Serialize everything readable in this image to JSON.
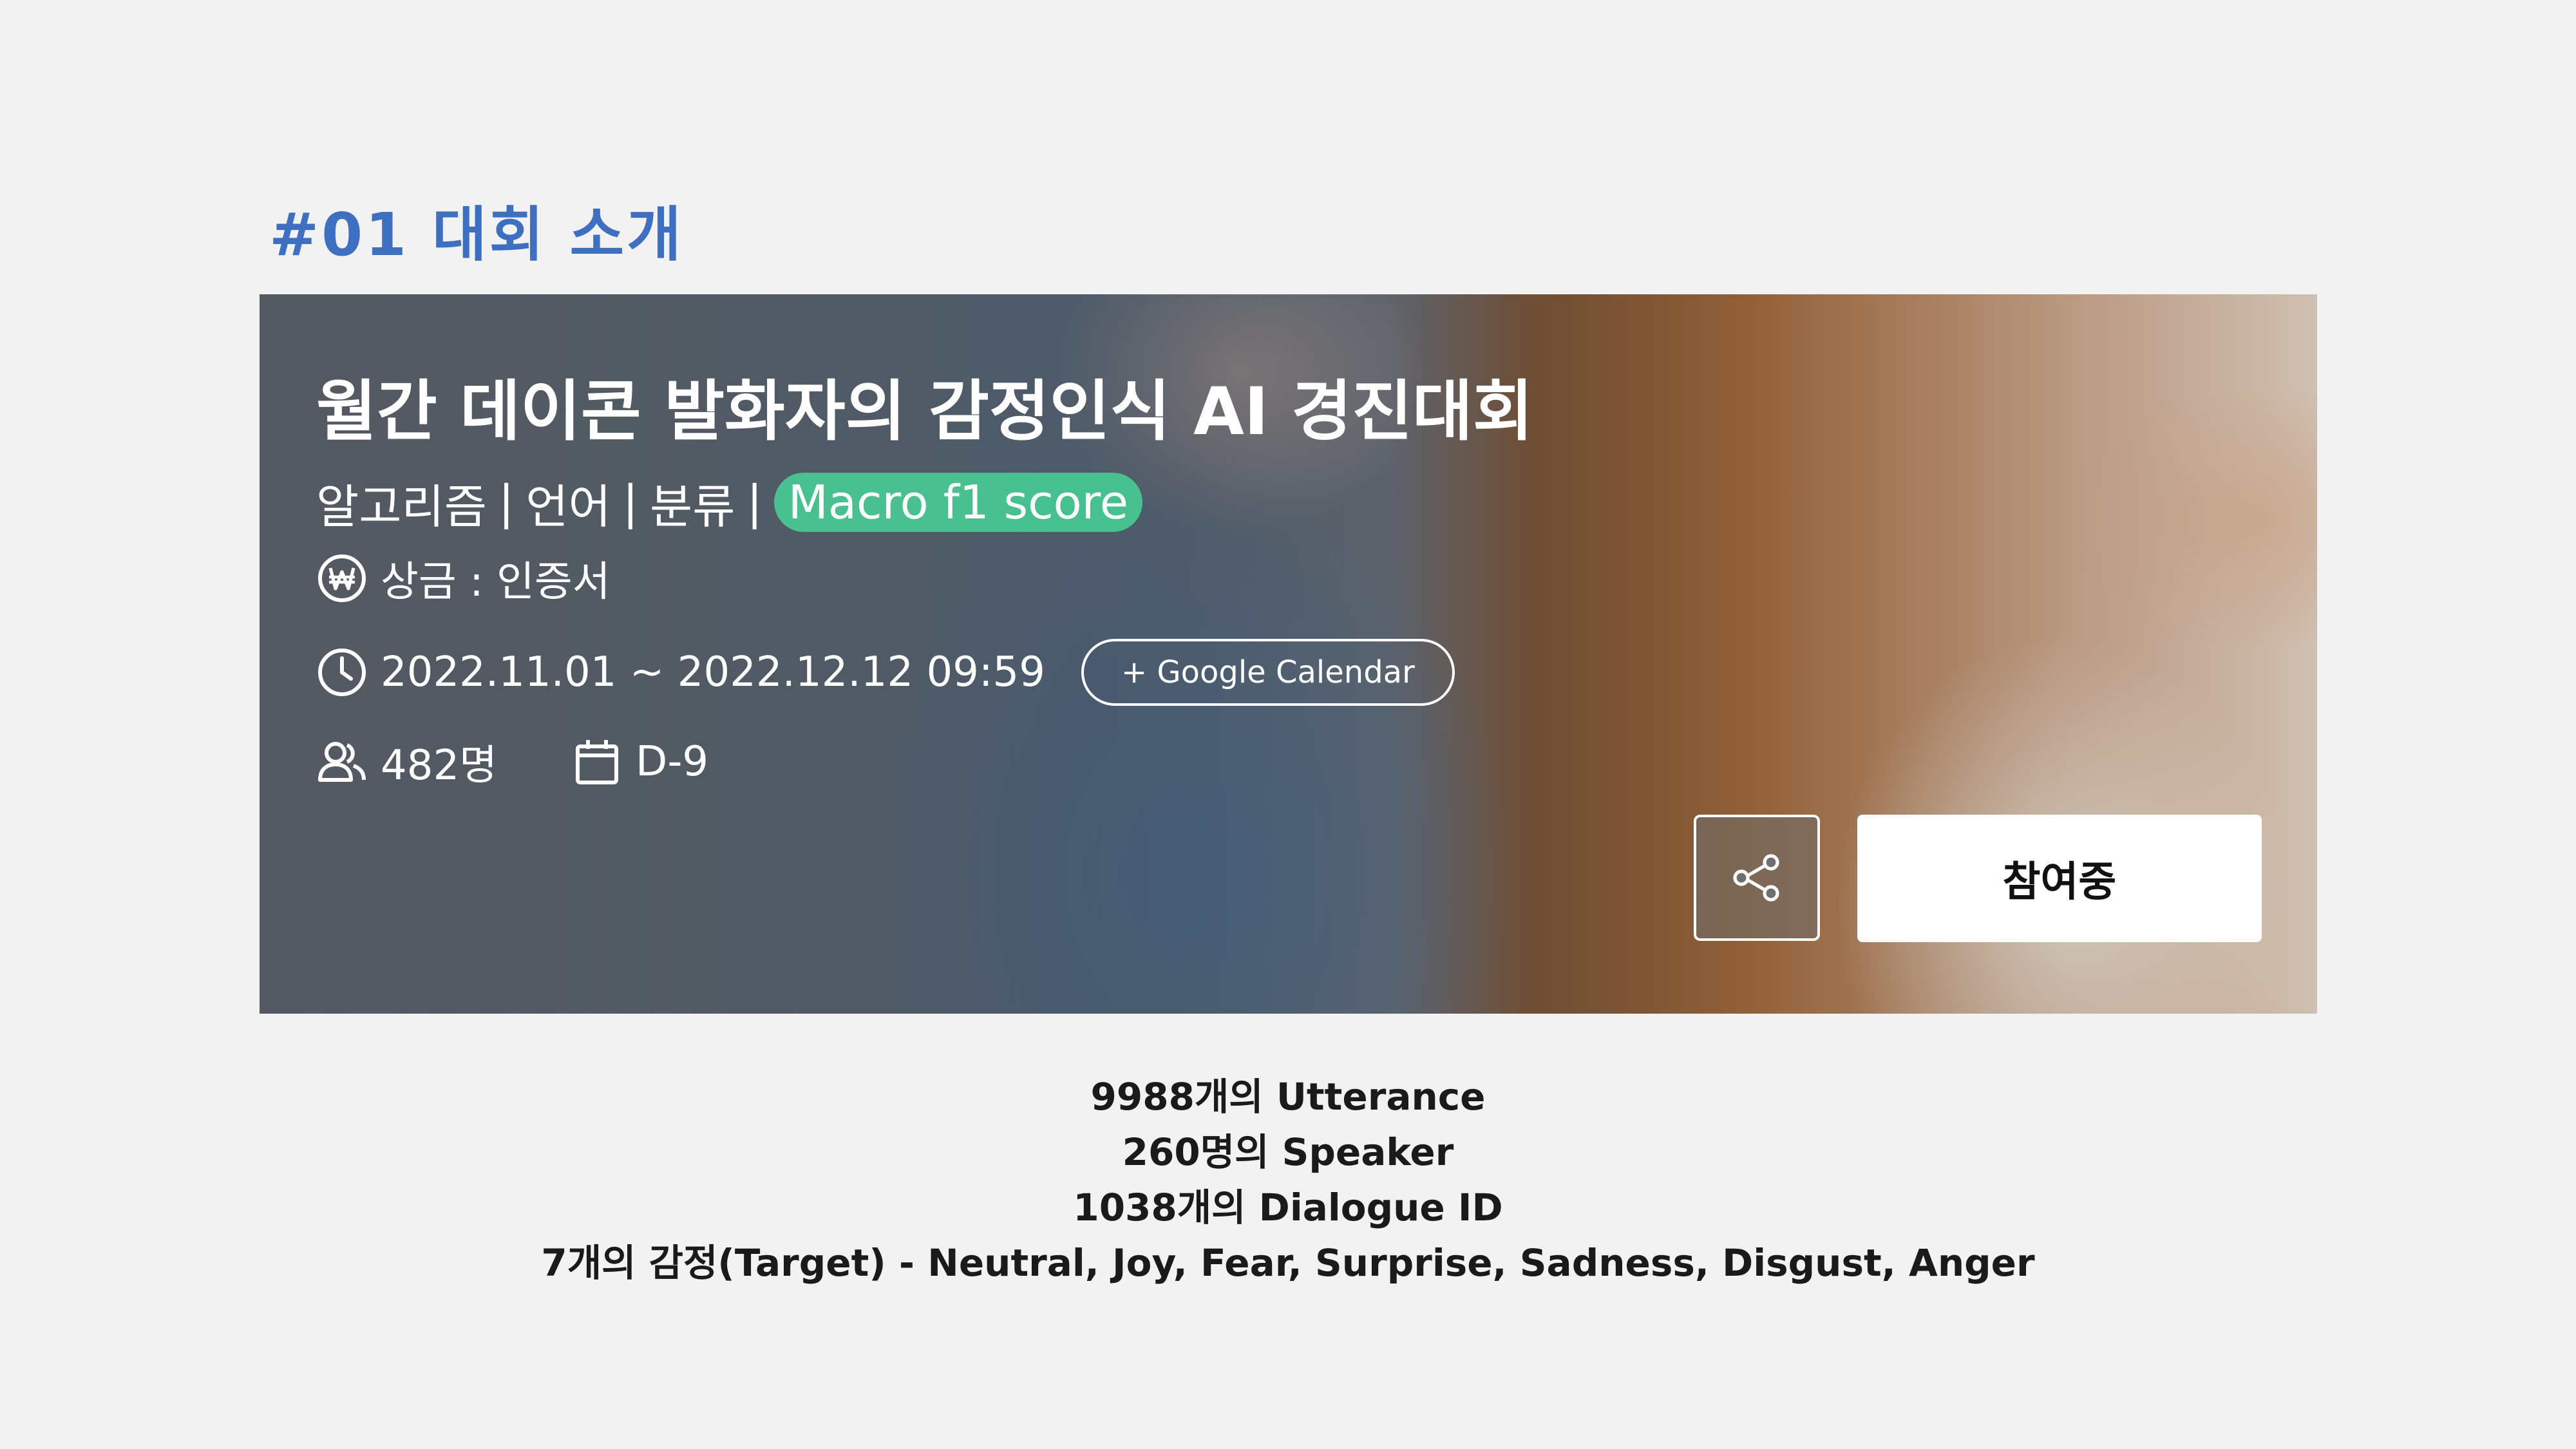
{
  "section": {
    "title": "#01 대회 소개"
  },
  "banner": {
    "title": "월간 데이콘 발화자의 감정인식 AI 경진대회",
    "tags": [
      "알고리즘",
      "언어",
      "분류"
    ],
    "tag_separator": "|",
    "metric_tag": "Macro f1 score",
    "prize": "상금 : 인증서",
    "period": "2022.11.01 ~ 2022.12.12 09:59",
    "calendar_button": "+ Google Calendar",
    "participants": "482명",
    "dday": "D-9",
    "join_button": "참여중"
  },
  "stats": [
    "9988개의 Utterance",
    "260명의 Speaker",
    "1038개의 Dialogue ID",
    "7개의 감정(Target) - Neutral, Joy, Fear, Surprise, Sadness, Disgust, Anger"
  ],
  "colors": {
    "section_title": "#3e6fc0",
    "tag_highlight": "#46d296",
    "page_background": "#f2f2f2"
  },
  "icons": [
    "won-icon",
    "clock-icon",
    "users-icon",
    "calendar-icon",
    "share-icon"
  ]
}
